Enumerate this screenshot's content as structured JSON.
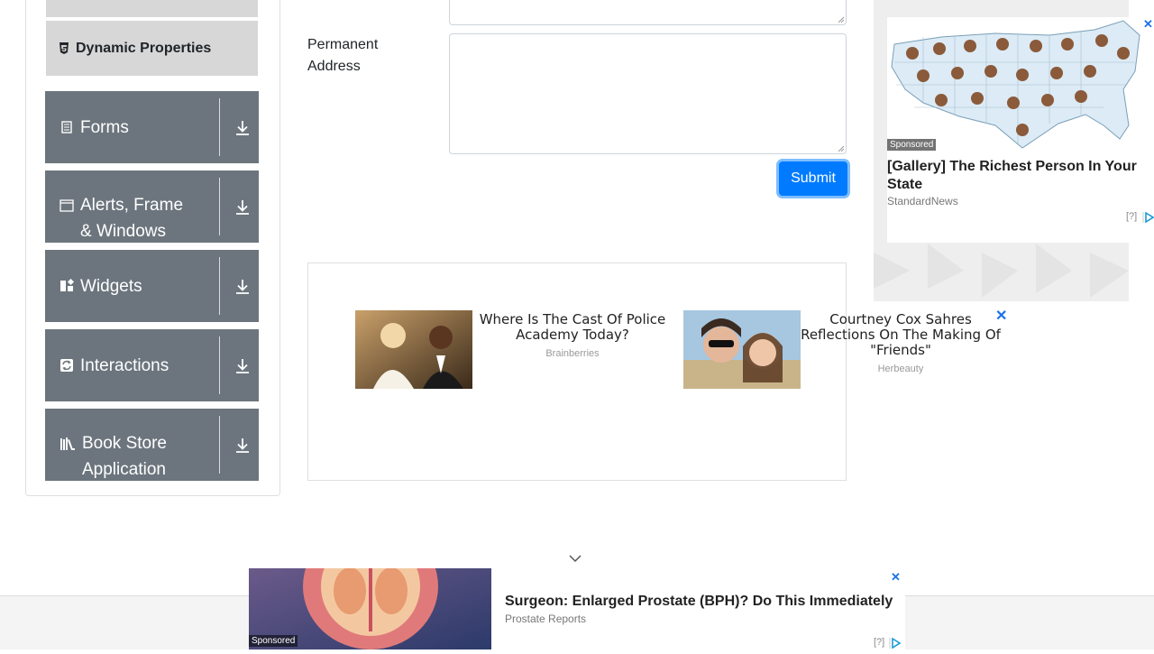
{
  "sidebar": {
    "dynamic_properties": "Dynamic Properties",
    "groups": [
      {
        "label": "Forms",
        "icon": "form-icon"
      },
      {
        "label": "Alerts, Frame & Windows",
        "icon": "window-icon"
      },
      {
        "label": "Widgets",
        "icon": "widgets-icon"
      },
      {
        "label": "Interactions",
        "icon": "interactions-icon"
      },
      {
        "label": "Book Store Application",
        "icon": "books-icon"
      }
    ]
  },
  "form": {
    "permanent_address_label": "Permanent Address",
    "submit_label": "Submit"
  },
  "ads": {
    "mid": [
      {
        "title": "Where Is The Cast Of Police Academy Today?",
        "source": "Brainberries"
      },
      {
        "title": "Courtney Cox Sahres Reflections On The Making Of \"Friends\"",
        "source": "Herbeauty"
      }
    ],
    "right": {
      "sponsored": "Sponsored",
      "title": "[Gallery] The Richest Person In Your State",
      "source": "StandardNews",
      "help": "[?]"
    },
    "bottom": {
      "sponsored": "Sponsored",
      "title": "Surgeon: Enlarged Prostate (BPH)? Do This Immediately",
      "source": "Prostate Reports",
      "help": "[?]"
    },
    "close": "✕"
  },
  "colors": {
    "accent": "#007bff",
    "group_bg": "#6c757d",
    "active_item_bg": "#d7d7d7"
  }
}
